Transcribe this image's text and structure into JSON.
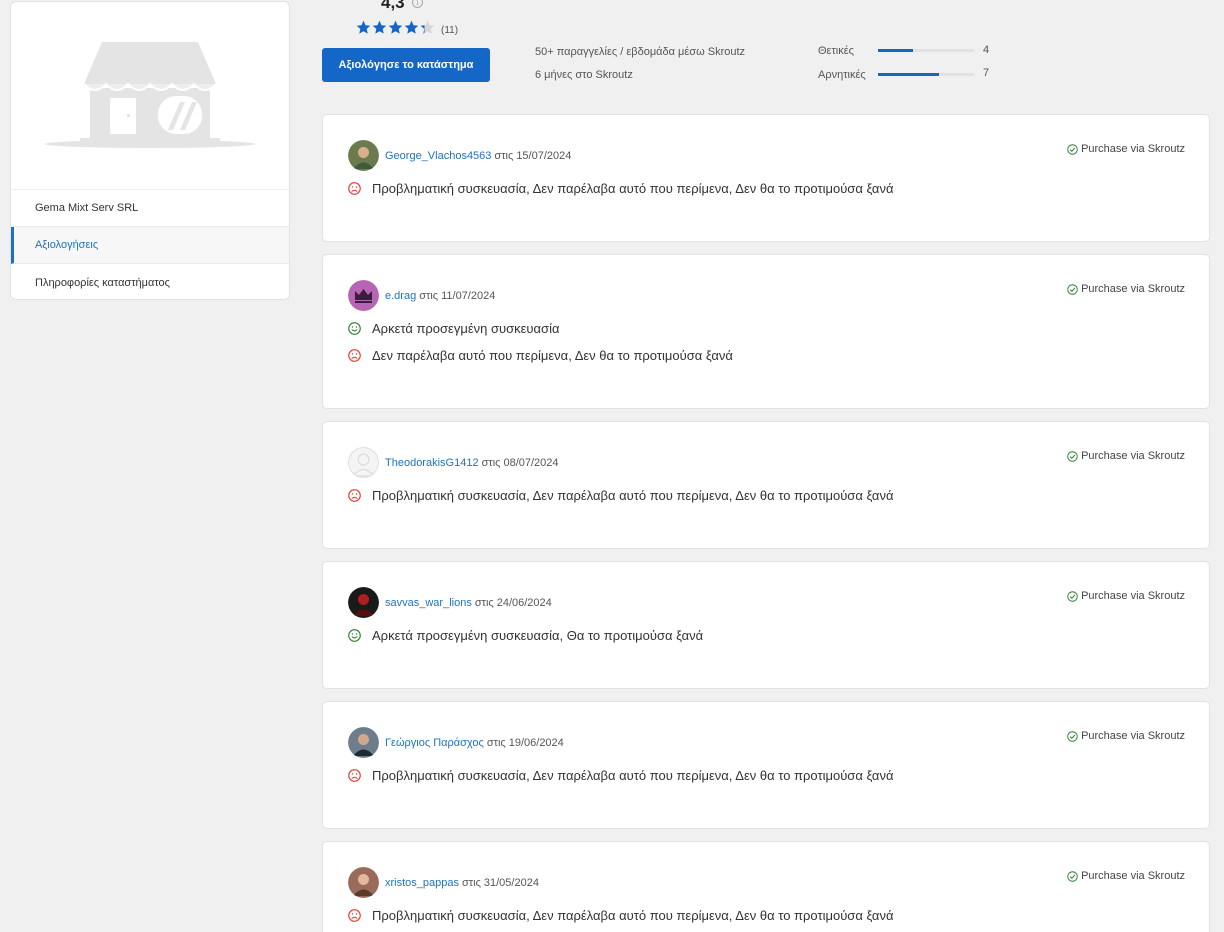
{
  "sidebar": {
    "shop_name": "Gema Mixt Serv SRL",
    "items": [
      {
        "label": "Αξιολογήσεις",
        "active": true
      },
      {
        "label": "Πληροφορίες καταστήματος",
        "active": false
      }
    ]
  },
  "summary": {
    "rating": "4,3",
    "stars": 4.3,
    "count": "(11)",
    "rate_button": "Αξιολόγησε το κατάστημα",
    "stats": [
      "50+ παραγγελίες / εβδομάδα μέσω Skroutz",
      "6 μήνες στο Skroutz"
    ],
    "positive_label": "Θετικές",
    "positive_count": "4",
    "positive_fraction": 0.36,
    "negative_label": "Αρνητικές",
    "negative_count": "7",
    "negative_fraction": 0.64
  },
  "colors": {
    "accent": "#1567c7",
    "positive": "#2e7d32",
    "negative": "#e53935",
    "star_empty": "#d6d6d6"
  },
  "reviews": [
    {
      "author": "George_Vlachos4563",
      "date_prefix": "στις",
      "date": "15/07/2024",
      "verified": "Purchase via Skroutz",
      "lines": [
        {
          "sentiment": "negative",
          "text": "Προβληματική συσκευασία,  Δεν παρέλαβα αυτό που περίμενα,  Δεν θα το προτιμούσα ξανά"
        }
      ]
    },
    {
      "author": "e.drag",
      "date_prefix": "στις",
      "date": "11/07/2024",
      "verified": "Purchase via Skroutz",
      "lines": [
        {
          "sentiment": "positive",
          "text": "Αρκετά προσεγμένη συσκευασία"
        },
        {
          "sentiment": "negative",
          "text": "Δεν παρέλαβα αυτό που περίμενα,  Δεν θα το προτιμούσα ξανά"
        }
      ]
    },
    {
      "author": "TheodorakisG1412",
      "date_prefix": "στις",
      "date": "08/07/2024",
      "verified": "Purchase via Skroutz",
      "lines": [
        {
          "sentiment": "negative",
          "text": "Προβληματική συσκευασία,  Δεν παρέλαβα αυτό που περίμενα,  Δεν θα το προτιμούσα ξανά"
        }
      ]
    },
    {
      "author": "savvas_war_lions",
      "date_prefix": "στις",
      "date": "24/06/2024",
      "verified": "Purchase via Skroutz",
      "lines": [
        {
          "sentiment": "positive",
          "text": "Αρκετά προσεγμένη συσκευασία,  Θα το προτιμούσα ξανά"
        }
      ]
    },
    {
      "author": "Γεώργιος Παράσχος",
      "date_prefix": "στις",
      "date": "19/06/2024",
      "verified": "Purchase via Skroutz",
      "lines": [
        {
          "sentiment": "negative",
          "text": "Προβληματική συσκευασία,  Δεν παρέλαβα αυτό που περίμενα,  Δεν θα το προτιμούσα ξανά"
        }
      ]
    },
    {
      "author": "xristos_pappas",
      "date_prefix": "στις",
      "date": "31/05/2024",
      "verified": "Purchase via Skroutz",
      "lines": [
        {
          "sentiment": "negative",
          "text": "Προβληματική συσκευασία,  Δεν παρέλαβα αυτό που περίμενα,  Δεν θα το προτιμούσα ξανά"
        }
      ]
    }
  ]
}
